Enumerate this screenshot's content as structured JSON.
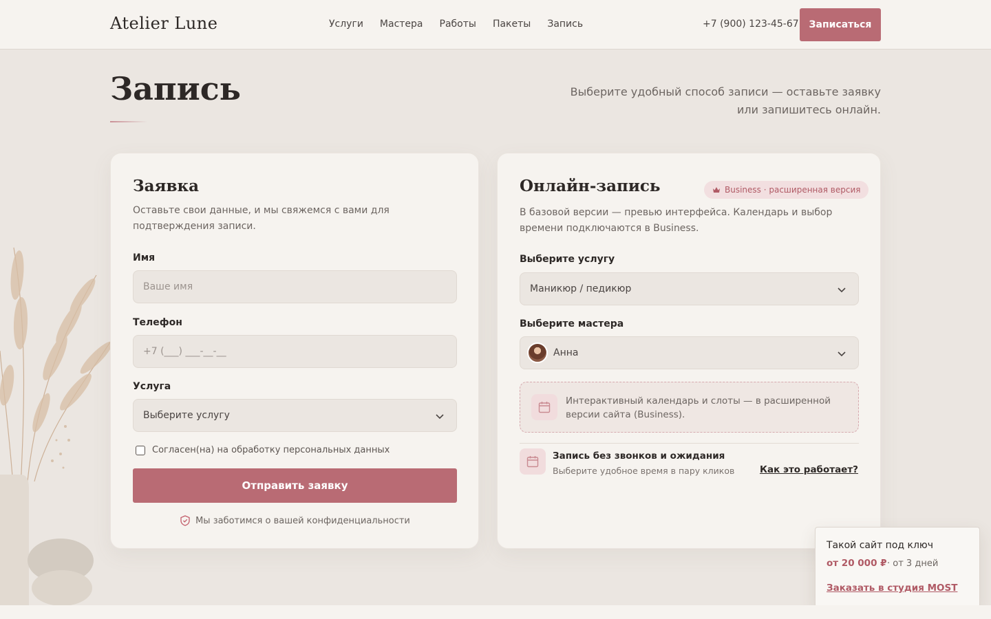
{
  "header": {
    "logo": "Atelier Lune",
    "nav": [
      "Услуги",
      "Мастера",
      "Работы",
      "Пакеты",
      "Запись"
    ],
    "phone": "+7 (900) 123-45-67",
    "cta": "Записаться"
  },
  "page": {
    "title": "Запись",
    "subtitle": "Выберите удобный способ записи — оставьте заявку или запишитесь онлайн."
  },
  "request_form": {
    "title": "Заявка",
    "description": "Оставьте свои данные, и мы свяжемся с вами для подтверждения записи.",
    "name_label": "Имя",
    "name_placeholder": "Ваше имя",
    "phone_label": "Телефон",
    "phone_placeholder": "+7 (___) ___-__-__",
    "service_label": "Услуга",
    "service_value": "Выберите услугу",
    "consent": "Согласен(на) на обработку персональных данных",
    "consent_checked": false,
    "submit": "Отправить заявку",
    "privacy": "Мы заботимся о вашей конфиденциальности"
  },
  "online_booking": {
    "title": "Онлайн-запись",
    "badge": "Business · расширенная версия",
    "description": "В базовой версии — превью интерфейса. Календарь и выбор времени подключаются в Business.",
    "service_label": "Выберите услугу",
    "service_value": "Маникюр / педикюр",
    "master_label": "Выберите мастера",
    "master_value": "Анна",
    "notice": "Интерактивный календарь и слоты — в расширенной версии сайта (Business).",
    "feature_title": "Запись без звонков и ожидания",
    "feature_sub": "Выберите удобное время в пару кликов",
    "how_link": "Как это работает?"
  },
  "promo": {
    "title": "Такой сайт под ключ",
    "price": "от 20 000 ₽",
    "time": "· от 3 дней",
    "link": "Заказать в студия MOST"
  },
  "colors": {
    "accent": "#b96b74",
    "background": "#ebe6e1",
    "surface": "#f6f3ef",
    "text": "#2d2826"
  },
  "icons": [
    "chevron-down-icon",
    "crown-icon",
    "calendar-icon",
    "shield-check-icon"
  ]
}
